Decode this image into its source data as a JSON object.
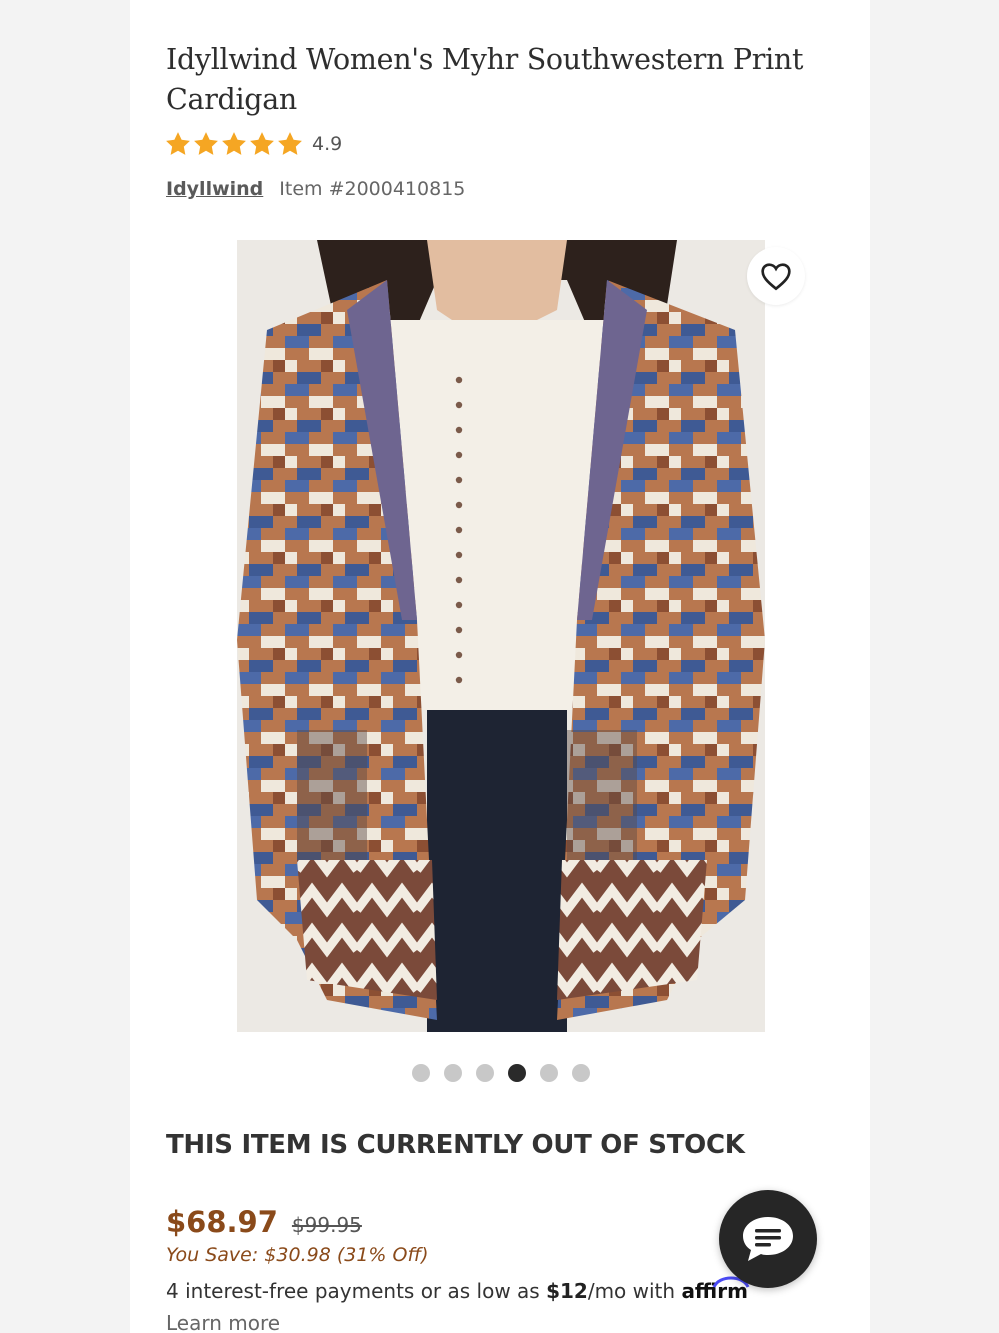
{
  "product": {
    "title": "Idyllwind Women's Myhr Southwestern Print Cardigan",
    "rating": "4.9",
    "star_count": 5,
    "brand": "Idyllwind",
    "item_number": "Item #2000410815"
  },
  "gallery": {
    "image_alt": "Idyllwind Women's Myhr Southwestern Print Cardigan",
    "total_images": 6,
    "active_index": 3
  },
  "stock": {
    "message": "THIS ITEM IS CURRENTLY OUT OF STOCK"
  },
  "pricing": {
    "sale_price": "$68.97",
    "original_price": "$99.95",
    "savings": "You Save: $30.98 (31% Off)",
    "affirm_prefix": "4 interest-free payments or as low as ",
    "affirm_amount": "$12",
    "affirm_suffix": "/mo with ",
    "affirm_brand": "affirm",
    "affirm_link": "Learn more"
  },
  "icons": {
    "star": "star-icon",
    "wishlist": "heart-icon",
    "chat": "chat-bubble-icon"
  },
  "colors": {
    "star": "#f5a623",
    "price": "#8a4a1a",
    "chat_button": "#262626"
  }
}
